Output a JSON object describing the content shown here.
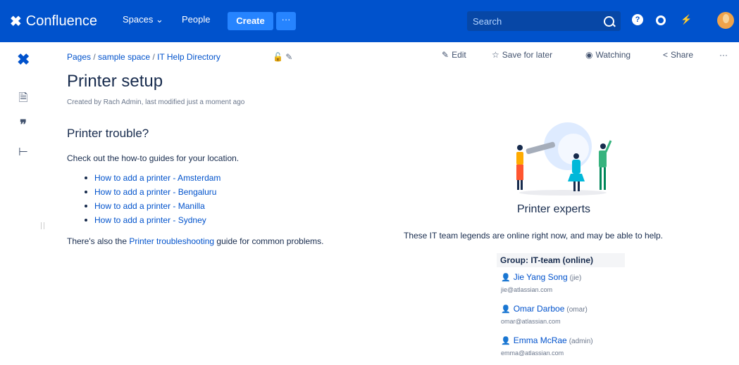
{
  "topnav": {
    "brand": "Confluence",
    "spaces": "Spaces ⌄",
    "people": "People",
    "create": "Create",
    "more": "···",
    "search_placeholder": "Search"
  },
  "breadcrumb": [
    "Pages",
    "sample space",
    "IT Help Directory"
  ],
  "actions": {
    "edit": "Edit",
    "save": "Save for later",
    "watching": "Watching",
    "share": "Share",
    "more": "···"
  },
  "page": {
    "title": "Printer setup",
    "byline": "Created by Rach Admin, last modified just a moment ago",
    "heading": "Printer trouble?",
    "intro": "Check out the how-to guides for your location.",
    "guides": [
      "How to add a printer - Amsterdam",
      "How to add a printer - Bengaluru",
      "How to add a printer - Manilla",
      "How to add a printer - Sydney"
    ],
    "also_pre": "There's also the ",
    "also_link": "Printer troubleshooting",
    "also_post": " guide for common problems."
  },
  "experts": {
    "title": "Printer experts",
    "desc": "These IT team legends are online right now, and may be able to help.",
    "group": "Group: IT-team (online)",
    "members": [
      {
        "name": "Jie Yang Song",
        "handle": "(jie)",
        "email": "jie@atlassian.com"
      },
      {
        "name": "Omar Darboe",
        "handle": "(omar)",
        "email": "omar@atlassian.com"
      },
      {
        "name": "Emma McRae",
        "handle": "(admin)",
        "email": "emma@atlassian.com"
      }
    ]
  },
  "colors": {
    "nav": "#0052cc",
    "create": "#2684ff",
    "link": "#0052cc"
  },
  "icons": [
    "confluence-logo-icon",
    "search-icon",
    "help-icon",
    "settings-icon",
    "notifications-icon",
    "pages-icon",
    "blog-icon",
    "page-tree-icon",
    "restriction-icon",
    "attachment-icon",
    "user-icon"
  ]
}
